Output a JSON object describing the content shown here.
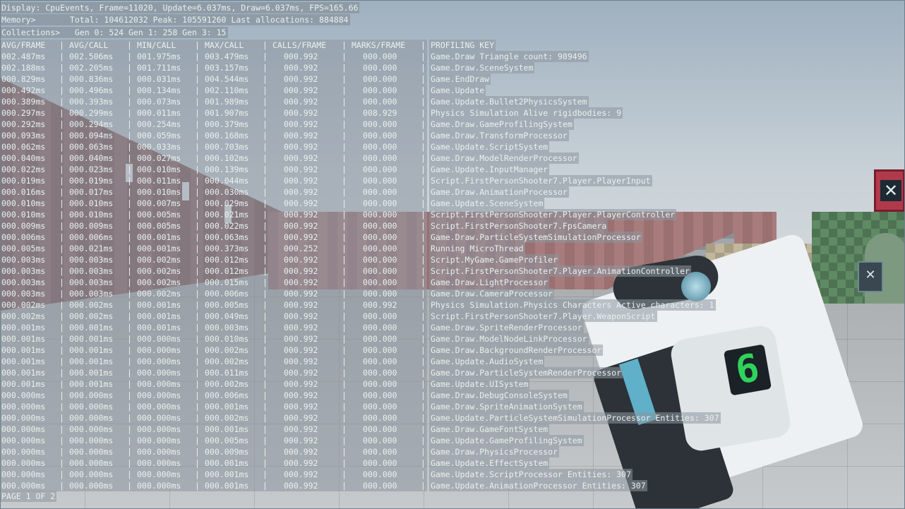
{
  "header": {
    "display": "Display: CpuEvents, Frame=11020, Update=6.037ms, Draw=6.037ms, FPS=165.66",
    "memory": "Memory>       Total: 104612032 Peak: 105591260 Last allocations: 884884",
    "collections": "Collections>   Gen 0: 524 Gen 1: 258 Gen 3: 15"
  },
  "columns": [
    "AVG/FRAME",
    "AVG/CALL",
    "MIN/CALL",
    "MAX/CALL",
    "CALLS/FRAME",
    "MARKS/FRAME",
    "PROFILING KEY"
  ],
  "rows": [
    {
      "avg_frame": "002.487ms",
      "avg_call": "002.506ms",
      "min_call": "001.975ms",
      "max_call": "003.479ms",
      "calls": "000.992",
      "marks": "000.000",
      "key": "Game.Draw Triangle count: 989496"
    },
    {
      "avg_frame": "002.188ms",
      "avg_call": "002.205ms",
      "min_call": "001.711ms",
      "max_call": "003.157ms",
      "calls": "000.992",
      "marks": "000.000",
      "key": "Game.Draw.SceneSystem"
    },
    {
      "avg_frame": "000.829ms",
      "avg_call": "000.836ms",
      "min_call": "000.031ms",
      "max_call": "004.544ms",
      "calls": "000.992",
      "marks": "000.000",
      "key": "Game.EndDraw"
    },
    {
      "avg_frame": "000.492ms",
      "avg_call": "000.496ms",
      "min_call": "000.134ms",
      "max_call": "002.110ms",
      "calls": "000.992",
      "marks": "000.000",
      "key": "Game.Update"
    },
    {
      "avg_frame": "000.389ms",
      "avg_call": "000.393ms",
      "min_call": "000.073ms",
      "max_call": "001.989ms",
      "calls": "000.992",
      "marks": "000.000",
      "key": "Game.Update.Bullet2PhysicsSystem"
    },
    {
      "avg_frame": "000.297ms",
      "avg_call": "000.299ms",
      "min_call": "000.011ms",
      "max_call": "001.907ms",
      "calls": "000.992",
      "marks": "008.929",
      "key": "Physics Simulation Alive rigidbodies: 9"
    },
    {
      "avg_frame": "000.292ms",
      "avg_call": "000.294ms",
      "min_call": "000.254ms",
      "max_call": "000.379ms",
      "calls": "000.992",
      "marks": "000.000",
      "key": "Game.Draw.GameProfilingSystem"
    },
    {
      "avg_frame": "000.093ms",
      "avg_call": "000.094ms",
      "min_call": "000.059ms",
      "max_call": "000.168ms",
      "calls": "000.992",
      "marks": "000.000",
      "key": "Game.Draw.TransformProcessor"
    },
    {
      "avg_frame": "000.062ms",
      "avg_call": "000.063ms",
      "min_call": "000.033ms",
      "max_call": "000.703ms",
      "calls": "000.992",
      "marks": "000.000",
      "key": "Game.Update.ScriptSystem"
    },
    {
      "avg_frame": "000.040ms",
      "avg_call": "000.040ms",
      "min_call": "000.027ms",
      "max_call": "000.102ms",
      "calls": "000.992",
      "marks": "000.000",
      "key": "Game.Draw.ModelRenderProcessor"
    },
    {
      "avg_frame": "000.022ms",
      "avg_call": "000.023ms",
      "min_call": "000.010ms",
      "max_call": "000.139ms",
      "calls": "000.992",
      "marks": "000.000",
      "key": "Game.Update.InputManager"
    },
    {
      "avg_frame": "000.019ms",
      "avg_call": "000.019ms",
      "min_call": "000.011ms",
      "max_call": "000.044ms",
      "calls": "000.992",
      "marks": "000.000",
      "key": "Script.FirstPersonShooter7.Player.PlayerInput"
    },
    {
      "avg_frame": "000.016ms",
      "avg_call": "000.017ms",
      "min_call": "000.010ms",
      "max_call": "000.030ms",
      "calls": "000.992",
      "marks": "000.000",
      "key": "Game.Draw.AnimationProcessor"
    },
    {
      "avg_frame": "000.010ms",
      "avg_call": "000.010ms",
      "min_call": "000.007ms",
      "max_call": "000.029ms",
      "calls": "000.992",
      "marks": "000.000",
      "key": "Game.Update.SceneSystem"
    },
    {
      "avg_frame": "000.010ms",
      "avg_call": "000.010ms",
      "min_call": "000.005ms",
      "max_call": "000.021ms",
      "calls": "000.992",
      "marks": "000.000",
      "key": "Script.FirstPersonShooter7.Player.PlayerController"
    },
    {
      "avg_frame": "000.009ms",
      "avg_call": "000.009ms",
      "min_call": "000.005ms",
      "max_call": "000.022ms",
      "calls": "000.992",
      "marks": "000.000",
      "key": "Script.FirstPersonShooter7.FpsCamera"
    },
    {
      "avg_frame": "000.006ms",
      "avg_call": "000.006ms",
      "min_call": "000.001ms",
      "max_call": "000.063ms",
      "calls": "000.992",
      "marks": "000.000",
      "key": "Game.Draw.ParticleSystemSimulationProcessor"
    },
    {
      "avg_frame": "000.005ms",
      "avg_call": "000.021ms",
      "min_call": "000.001ms",
      "max_call": "000.373ms",
      "calls": "000.252",
      "marks": "000.000",
      "key": "Running MicroThread"
    },
    {
      "avg_frame": "000.003ms",
      "avg_call": "000.003ms",
      "min_call": "000.002ms",
      "max_call": "000.012ms",
      "calls": "000.992",
      "marks": "000.000",
      "key": "Script.MyGame.GameProfiler"
    },
    {
      "avg_frame": "000.003ms",
      "avg_call": "000.003ms",
      "min_call": "000.002ms",
      "max_call": "000.012ms",
      "calls": "000.992",
      "marks": "000.000",
      "key": "Script.FirstPersonShooter7.Player.AnimationController"
    },
    {
      "avg_frame": "000.003ms",
      "avg_call": "000.003ms",
      "min_call": "000.002ms",
      "max_call": "000.015ms",
      "calls": "000.992",
      "marks": "000.000",
      "key": "Game.Draw.LightProcessor"
    },
    {
      "avg_frame": "000.003ms",
      "avg_call": "000.003ms",
      "min_call": "000.002ms",
      "max_call": "000.006ms",
      "calls": "000.992",
      "marks": "000.000",
      "key": "Game.Draw.CameraProcessor"
    },
    {
      "avg_frame": "000.002ms",
      "avg_call": "000.002ms",
      "min_call": "000.001ms",
      "max_call": "000.005ms",
      "calls": "000.992",
      "marks": "000.992",
      "key": "Physics Simulation.Physics Characters Active characters: 1"
    },
    {
      "avg_frame": "000.002ms",
      "avg_call": "000.002ms",
      "min_call": "000.001ms",
      "max_call": "000.049ms",
      "calls": "000.992",
      "marks": "000.000",
      "key": "Script.FirstPersonShooter7.Player.WeaponScript"
    },
    {
      "avg_frame": "000.001ms",
      "avg_call": "000.001ms",
      "min_call": "000.001ms",
      "max_call": "000.003ms",
      "calls": "000.992",
      "marks": "000.000",
      "key": "Game.Draw.SpriteRenderProcessor"
    },
    {
      "avg_frame": "000.001ms",
      "avg_call": "000.001ms",
      "min_call": "000.000ms",
      "max_call": "000.010ms",
      "calls": "000.992",
      "marks": "000.000",
      "key": "Game.Draw.ModelNodeLinkProcessor"
    },
    {
      "avg_frame": "000.001ms",
      "avg_call": "000.001ms",
      "min_call": "000.000ms",
      "max_call": "000.002ms",
      "calls": "000.992",
      "marks": "000.000",
      "key": "Game.Draw.BackgroundRenderProcessor"
    },
    {
      "avg_frame": "000.001ms",
      "avg_call": "000.001ms",
      "min_call": "000.000ms",
      "max_call": "000.002ms",
      "calls": "000.992",
      "marks": "000.000",
      "key": "Game.Update.AudioSystem"
    },
    {
      "avg_frame": "000.001ms",
      "avg_call": "000.001ms",
      "min_call": "000.000ms",
      "max_call": "000.011ms",
      "calls": "000.992",
      "marks": "000.000",
      "key": "Game.Draw.ParticleSystemRenderProcessor"
    },
    {
      "avg_frame": "000.001ms",
      "avg_call": "000.001ms",
      "min_call": "000.000ms",
      "max_call": "000.002ms",
      "calls": "000.992",
      "marks": "000.000",
      "key": "Game.Update.UISystem"
    },
    {
      "avg_frame": "000.000ms",
      "avg_call": "000.000ms",
      "min_call": "000.000ms",
      "max_call": "000.006ms",
      "calls": "000.992",
      "marks": "000.000",
      "key": "Game.Draw.DebugConsoleSystem"
    },
    {
      "avg_frame": "000.000ms",
      "avg_call": "000.000ms",
      "min_call": "000.000ms",
      "max_call": "000.001ms",
      "calls": "000.992",
      "marks": "000.000",
      "key": "Game.Draw.SpriteAnimationSystem"
    },
    {
      "avg_frame": "000.000ms",
      "avg_call": "000.000ms",
      "min_call": "000.000ms",
      "max_call": "000.002ms",
      "calls": "000.992",
      "marks": "000.000",
      "key": "Game.Update.ParticleSystemSimulationProcessor Entities: 307"
    },
    {
      "avg_frame": "000.000ms",
      "avg_call": "000.000ms",
      "min_call": "000.000ms",
      "max_call": "000.001ms",
      "calls": "000.992",
      "marks": "000.000",
      "key": "Game.Draw.GameFontSystem"
    },
    {
      "avg_frame": "000.000ms",
      "avg_call": "000.000ms",
      "min_call": "000.000ms",
      "max_call": "000.005ms",
      "calls": "000.992",
      "marks": "000.000",
      "key": "Game.Update.GameProfilingSystem"
    },
    {
      "avg_frame": "000.000ms",
      "avg_call": "000.000ms",
      "min_call": "000.000ms",
      "max_call": "000.009ms",
      "calls": "000.992",
      "marks": "000.000",
      "key": "Game.Draw.PhysicsProcessor"
    },
    {
      "avg_frame": "000.000ms",
      "avg_call": "000.000ms",
      "min_call": "000.000ms",
      "max_call": "000.001ms",
      "calls": "000.992",
      "marks": "000.000",
      "key": "Game.Update.EffectSystem"
    },
    {
      "avg_frame": "000.000ms",
      "avg_call": "000.000ms",
      "min_call": "000.000ms",
      "max_call": "000.001ms",
      "calls": "000.992",
      "marks": "000.000",
      "key": "Game.Update.ScriptProcessor Entities: 307"
    },
    {
      "avg_frame": "000.000ms",
      "avg_call": "000.000ms",
      "min_call": "000.000ms",
      "max_call": "000.001ms",
      "calls": "000.992",
      "marks": "000.000",
      "key": "Game.Update.AnimationProcessor Entities: 307"
    }
  ],
  "footer": "PAGE 1 OF 2",
  "weapon_display_digit": "6",
  "crate_symbol": "✕",
  "colors": {
    "overlay_text": "#e9f2ee",
    "digit": "#2fd35a",
    "crate": "#b03a4c"
  }
}
